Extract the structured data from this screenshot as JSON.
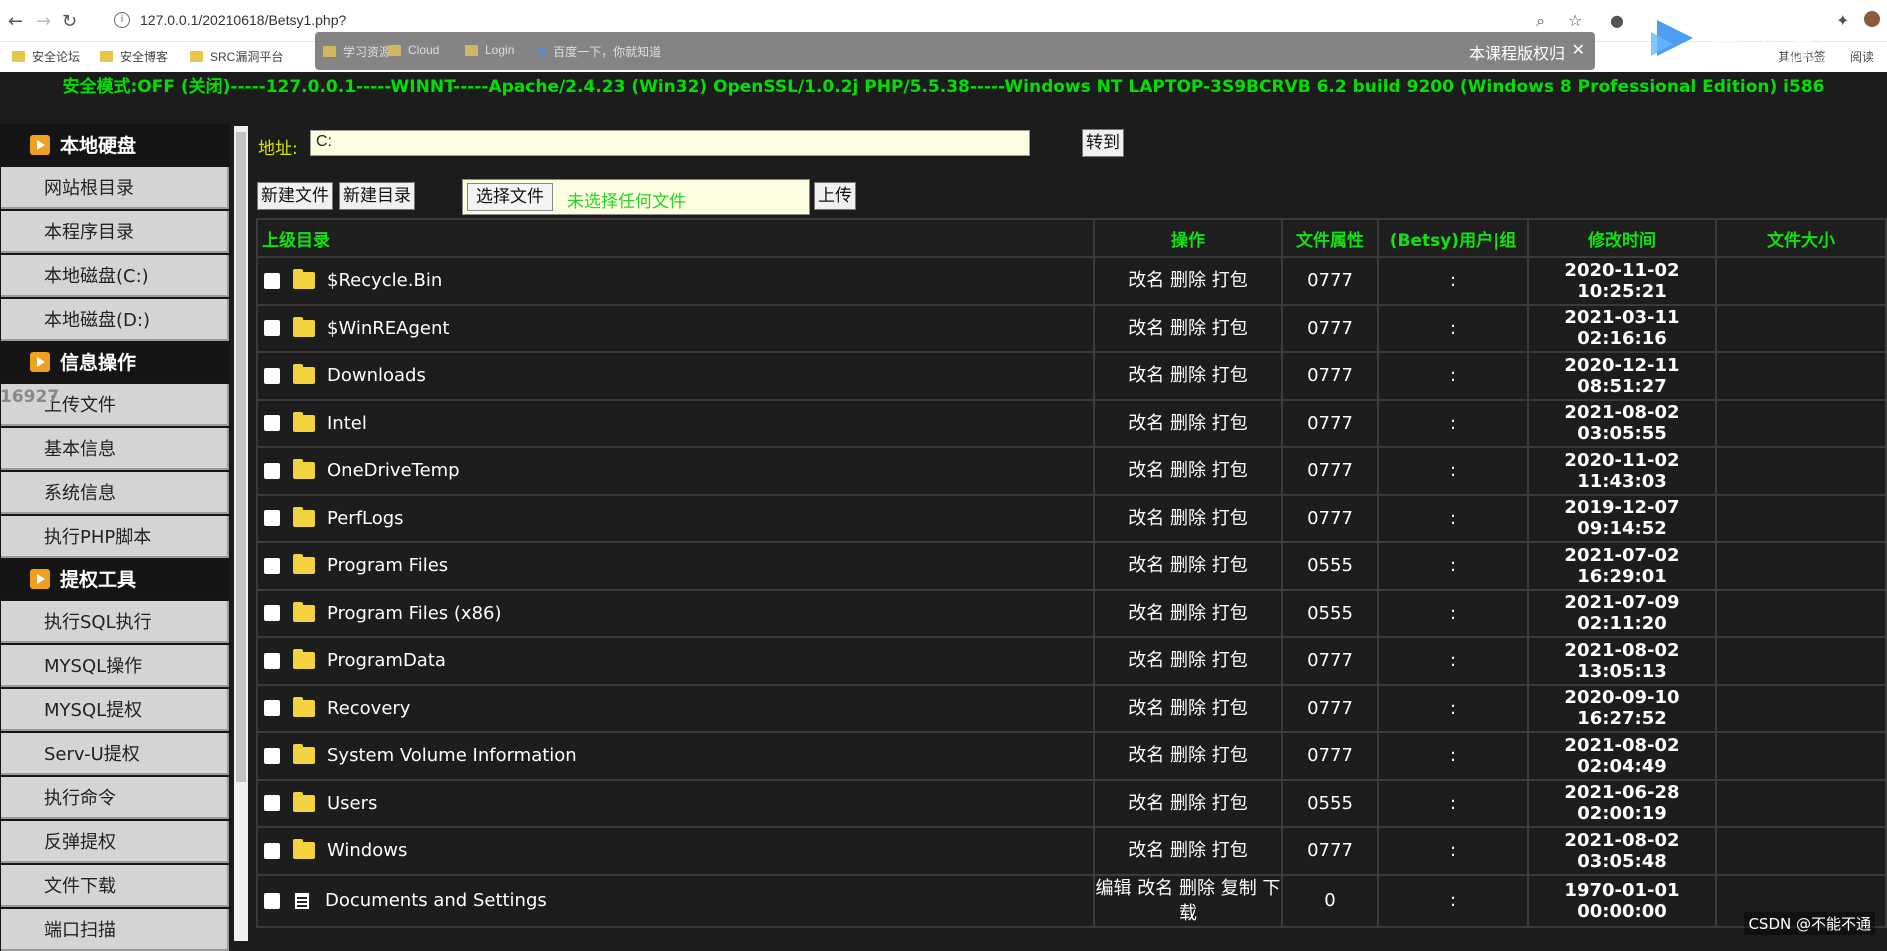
{
  "browser": {
    "url": "127.0.0.1/20210618/Betsy1.php?",
    "bookmarks": [
      "安全论坛",
      "安全博客",
      "SRC漏洞平台",
      "学习资源",
      "Cloud",
      "Login",
      "百度一下，你就知道"
    ],
    "right_bookmark": "其他书签",
    "right_bookmark2": "阅读",
    "banner_text": "本课程版权归",
    "logo_text": "腾讯课堂"
  },
  "status_line": "安全模式:OFF (关闭)-----127.0.0.1-----WINNT-----Apache/2.4.23 (Win32) OpenSSL/1.0.2j PHP/5.5.38-----Windows NT LAPTOP-3S9BCRVB 6.2 build 9200 (Windows 8 Professional Edition) i586",
  "sidebar": {
    "sections": [
      {
        "title": "本地硬盘",
        "items": [
          "网站根目录",
          "本程序目录",
          "本地磁盘(C:)",
          "本地磁盘(D:)"
        ]
      },
      {
        "title": "信息操作",
        "items": [
          "上传文件",
          "基本信息",
          "系统信息",
          "执行PHP脚本"
        ]
      },
      {
        "title": "提权工具",
        "items": [
          "执行SQL执行",
          "MYSQL操作",
          "MYSQL提权",
          "Serv-U提权",
          "执行命令",
          "反弹提权",
          "文件下载",
          "端口扫描"
        ]
      }
    ]
  },
  "overlay_left_text": "16927",
  "main": {
    "address_label": "地址:",
    "address_value": "C:",
    "go_button": "转到",
    "new_file": "新建文件",
    "new_dir": "新建目录",
    "choose_file": "选择文件",
    "no_file": "未选择任何文件",
    "upload": "上传",
    "headers": {
      "parent": "上级目录",
      "ops": "操作",
      "attr": "文件属性",
      "user": "(Betsy)用户|组",
      "mtime": "修改时间",
      "size": "文件大小"
    },
    "rows": [
      {
        "name": "$Recycle.Bin",
        "type": "folder",
        "ops": "改名 删除 打包",
        "attr": "0777",
        "user": ":",
        "time": "2020-11-02 10:25:21"
      },
      {
        "name": "$WinREAgent",
        "type": "folder",
        "ops": "改名 删除 打包",
        "attr": "0777",
        "user": ":",
        "time": "2021-03-11 02:16:16"
      },
      {
        "name": "Downloads",
        "type": "folder",
        "ops": "改名 删除 打包",
        "attr": "0777",
        "user": ":",
        "time": "2020-12-11 08:51:27"
      },
      {
        "name": "Intel",
        "type": "folder",
        "ops": "改名 删除 打包",
        "attr": "0777",
        "user": ":",
        "time": "2021-08-02 03:05:55"
      },
      {
        "name": "OneDriveTemp",
        "type": "folder",
        "ops": "改名 删除 打包",
        "attr": "0777",
        "user": ":",
        "time": "2020-11-02 11:43:03"
      },
      {
        "name": "PerfLogs",
        "type": "folder",
        "ops": "改名 删除 打包",
        "attr": "0777",
        "user": ":",
        "time": "2019-12-07 09:14:52"
      },
      {
        "name": "Program Files",
        "type": "folder",
        "ops": "改名 删除 打包",
        "attr": "0555",
        "user": ":",
        "time": "2021-07-02 16:29:01"
      },
      {
        "name": "Program Files (x86)",
        "type": "folder",
        "ops": "改名 删除 打包",
        "attr": "0555",
        "user": ":",
        "time": "2021-07-09 02:11:20"
      },
      {
        "name": "ProgramData",
        "type": "folder",
        "ops": "改名 删除 打包",
        "attr": "0777",
        "user": ":",
        "time": "2021-08-02 13:05:13"
      },
      {
        "name": "Recovery",
        "type": "folder",
        "ops": "改名 删除 打包",
        "attr": "0777",
        "user": ":",
        "time": "2020-09-10 16:27:52"
      },
      {
        "name": "System Volume Information",
        "type": "folder",
        "ops": "改名 删除 打包",
        "attr": "0777",
        "user": ":",
        "time": "2021-08-02 02:04:49"
      },
      {
        "name": "Users",
        "type": "folder",
        "ops": "改名 删除 打包",
        "attr": "0555",
        "user": ":",
        "time": "2021-06-28 02:00:19"
      },
      {
        "name": "Windows",
        "type": "folder",
        "ops": "改名 删除 打包",
        "attr": "0777",
        "user": ":",
        "time": "2021-08-02 03:05:48"
      },
      {
        "name": "Documents and Settings",
        "type": "file",
        "ops": "编辑 改名 删除 复制 下载",
        "attr": "0",
        "user": ":",
        "time": "1970-01-01 00:00:00"
      }
    ]
  },
  "watermark": "CSDN @不能不通"
}
